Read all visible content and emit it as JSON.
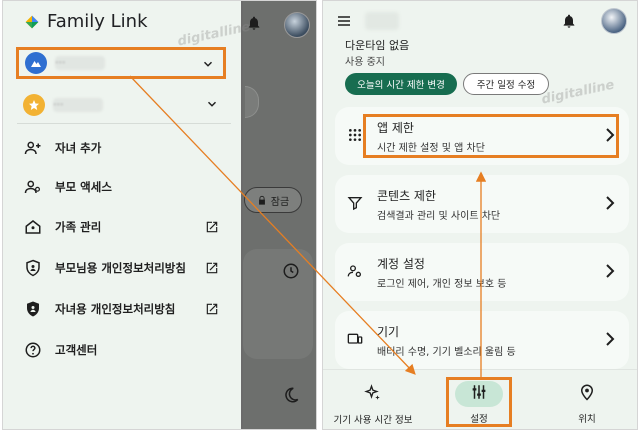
{
  "watermark": "digitalline",
  "left": {
    "brand": {
      "name": "Family Link"
    },
    "accounts": [
      {
        "name": "···",
        "avatar_color": "#2f6fd1"
      },
      {
        "name": "···",
        "avatar_color": "#f2b233"
      }
    ],
    "menu": [
      {
        "label": "자녀 추가",
        "icon": "add-person-icon",
        "external": false
      },
      {
        "label": "부모 액세스",
        "icon": "parent-access-icon",
        "external": false
      },
      {
        "label": "가족 관리",
        "icon": "home-icon",
        "external": true
      },
      {
        "label": "부모님용 개인정보처리방침",
        "icon": "shield-person-icon",
        "external": true
      },
      {
        "label": "자녀용 개인정보처리방침",
        "icon": "shield-person-icon",
        "external": true
      },
      {
        "label": "고객센터",
        "icon": "help-icon",
        "external": false
      }
    ],
    "background": {
      "lock_label": "잠금"
    }
  },
  "right": {
    "partial_title": "다운타임 없음",
    "partial_sub": "사용 중지",
    "chips": [
      "오늘의 시간 제한 변경",
      "주간 일정 수정"
    ],
    "cards": [
      {
        "title": "앱 제한",
        "subtitle": "시간 제한 설정 및 앱 차단",
        "icon": "apps-grid-icon"
      },
      {
        "title": "콘텐츠 제한",
        "subtitle": "검색결과 관리 및 사이트 차단",
        "icon": "filter-icon"
      },
      {
        "title": "계정 설정",
        "subtitle": "로그인 제어, 개인 정보 보호 등",
        "icon": "account-settings-icon"
      },
      {
        "title": "기기",
        "subtitle": "배터리 수명, 기기 벨소리 울림 등",
        "icon": "device-icon"
      }
    ],
    "bottom_nav": [
      {
        "label": "기기 사용 시간 정보",
        "icon": "sparkle-icon"
      },
      {
        "label": "설정",
        "icon": "tune-icon",
        "active": true
      },
      {
        "label": "위치",
        "icon": "location-icon"
      }
    ]
  },
  "colors": {
    "accent_orange": "#e67e22",
    "primary_green": "#176d50",
    "drawer_bg": "#eef4ef"
  }
}
